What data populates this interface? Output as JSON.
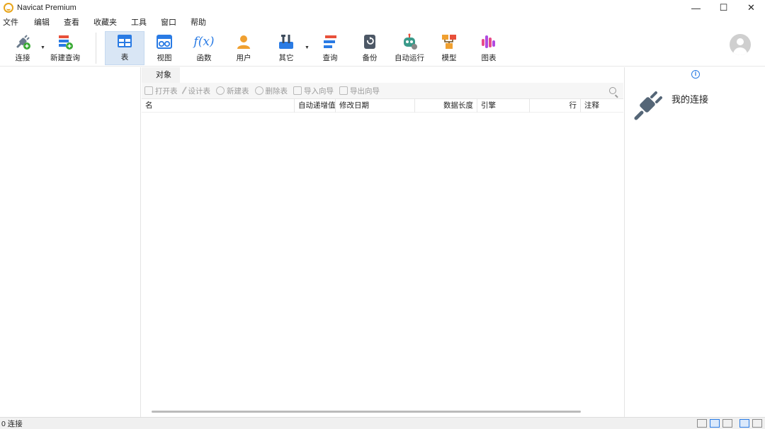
{
  "window": {
    "title": "Navicat Premium",
    "min": "—",
    "max": "☐",
    "close": "✕"
  },
  "menu": [
    "文件",
    "编辑",
    "查看",
    "收藏夹",
    "工具",
    "窗口",
    "帮助"
  ],
  "toolbar": {
    "items": [
      {
        "label": "连接",
        "icon": "connection-plug-icon",
        "dropdown": true
      },
      {
        "label": "新建查询",
        "icon": "new-query-icon"
      },
      {
        "label": "表",
        "icon": "table-icon",
        "active": true
      },
      {
        "label": "视图",
        "icon": "view-glasses-icon"
      },
      {
        "label": "函数",
        "icon": "function-icon"
      },
      {
        "label": "用户",
        "icon": "user-icon"
      },
      {
        "label": "其它",
        "icon": "tools-icon",
        "dropdown": true
      },
      {
        "label": "查询",
        "icon": "query-icon"
      },
      {
        "label": "备份",
        "icon": "backup-icon"
      },
      {
        "label": "自动运行",
        "icon": "robot-icon"
      },
      {
        "label": "模型",
        "icon": "model-icon"
      },
      {
        "label": "图表",
        "icon": "chart-icon"
      }
    ],
    "function_glyph": "f(x)"
  },
  "center": {
    "tab": "对象",
    "object_toolbar": [
      "打开表",
      "设计表",
      "新建表",
      "删除表",
      "导入向导",
      "导出向导"
    ],
    "columns": [
      "名",
      "自动递增值",
      "修改日期",
      "数据长度",
      "引擎",
      "行",
      "注释"
    ]
  },
  "right_pane": {
    "info": "i",
    "title": "我的连接"
  },
  "status": {
    "text": "0 连接"
  },
  "colors": {
    "accent": "#2a7be4",
    "active_tab_bg": "#d9e6f5"
  }
}
